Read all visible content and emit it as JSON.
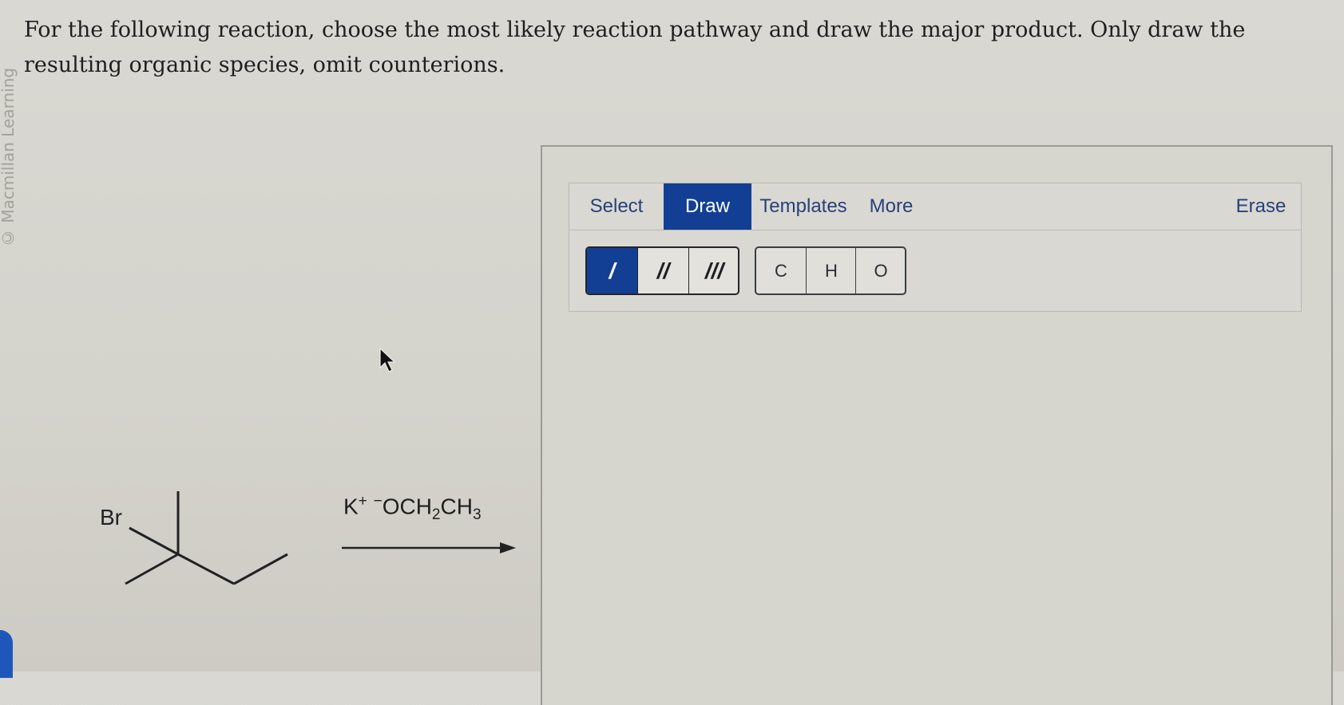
{
  "watermark": "© Macmillan Learning",
  "question": {
    "text": "For the following reaction, choose the most likely reaction pathway and draw the major product. Only draw the resulting organic species, omit counterions."
  },
  "reaction": {
    "substituent_label": "Br",
    "reagent": {
      "cation": "K",
      "cation_charge": "+",
      "anion_charge": "−",
      "anion_a": "OCH",
      "sub_a": "2",
      "anion_b": "CH",
      "sub_b": "3"
    }
  },
  "toolbar": {
    "tabs": {
      "select": "Select",
      "draw": "Draw",
      "templates": "Templates",
      "more": "More",
      "erase": "Erase"
    },
    "active_tab": "Draw"
  },
  "bonds": {
    "single": "/",
    "double": "//",
    "triple": "///",
    "active": "single"
  },
  "atoms": {
    "c": "C",
    "h": "H",
    "o": "O"
  },
  "colors": {
    "accent": "#123f93",
    "tab_text": "#27417a"
  }
}
